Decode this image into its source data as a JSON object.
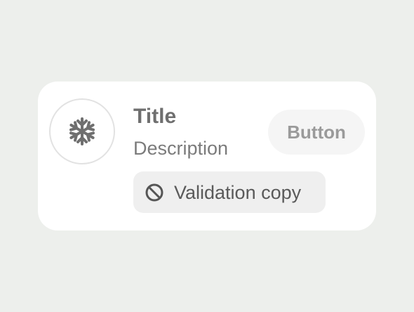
{
  "card": {
    "avatar_icon": "snowflake-icon",
    "title": "Title",
    "description": "Description",
    "button_label": "Button",
    "validation": {
      "icon": "prohibited-icon",
      "text": "Validation copy"
    }
  },
  "colors": {
    "background": "#edefec",
    "card": "#ffffff",
    "icon": "#6f6f6f",
    "button_bg": "#f5f5f5",
    "button_text": "#9a9a9a",
    "validation_bg": "#efefef"
  }
}
